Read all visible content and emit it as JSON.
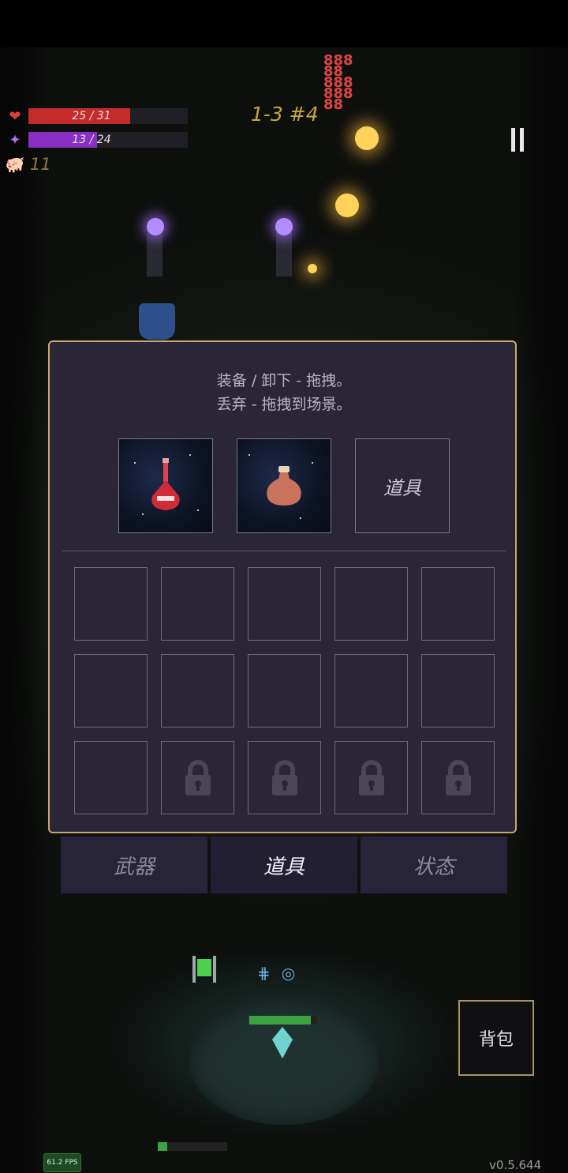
{
  "hud": {
    "hp_text": "25 / 31",
    "hp_fraction": 0.806,
    "mp_text": "13 / 24",
    "mp_fraction": 0.542,
    "coins": "11",
    "level": "1-3 #4"
  },
  "inventory": {
    "instruction_line1": "装备 / 卸下 - 拖拽。",
    "instruction_line2": "丢弃 - 拖拽到场景。",
    "equip_slots": [
      {
        "item": "red-potion-icon"
      },
      {
        "item": "clay-jar-icon"
      },
      {
        "label": "道具"
      }
    ],
    "grid_locked": [
      false,
      false,
      false,
      false,
      false,
      false,
      false,
      false,
      false,
      false,
      false,
      true,
      true,
      true,
      true
    ]
  },
  "tabs": {
    "weapons": "武器",
    "items": "道具",
    "status": "状态",
    "active": "items"
  },
  "bag_button": "背包",
  "fps": "61.2 FPS",
  "version": "v0.5.644",
  "colors": {
    "panel_bg": "#2a2638",
    "panel_border": "#c6a86a",
    "hp": "#c42b2b",
    "mp": "#8a2fc4",
    "level_text": "#c9a73c"
  }
}
